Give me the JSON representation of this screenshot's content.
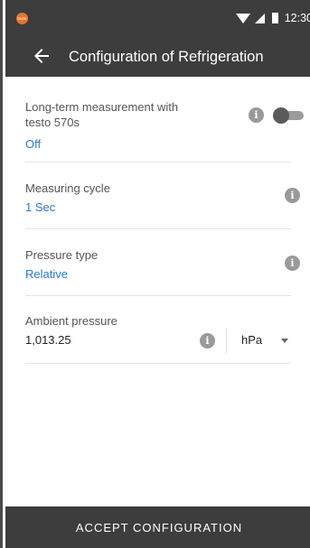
{
  "status_bar": {
    "brand_text": "testo",
    "time": "12:30"
  },
  "app_bar": {
    "back_icon": "arrow-left-icon",
    "title": "Configuration of Refrigeration"
  },
  "settings": {
    "long_term": {
      "label": "Long-term measurement with testo 570s",
      "value": "Off",
      "toggle_on": false
    },
    "measuring_cycle": {
      "label": "Measuring cycle",
      "value": "1 Sec"
    },
    "pressure_type": {
      "label": "Pressure type",
      "value": "Relative"
    },
    "ambient_pressure": {
      "label": "Ambient pressure",
      "value": "1,013.25",
      "unit": "hPa"
    }
  },
  "footer": {
    "accept_label": "ACCEPT CONFIGURATION"
  },
  "colors": {
    "bar": "#3d3d3d",
    "value_blue": "#2c7ac0",
    "brand_orange": "#e7752b",
    "info_gray": "#9a9a9a"
  }
}
